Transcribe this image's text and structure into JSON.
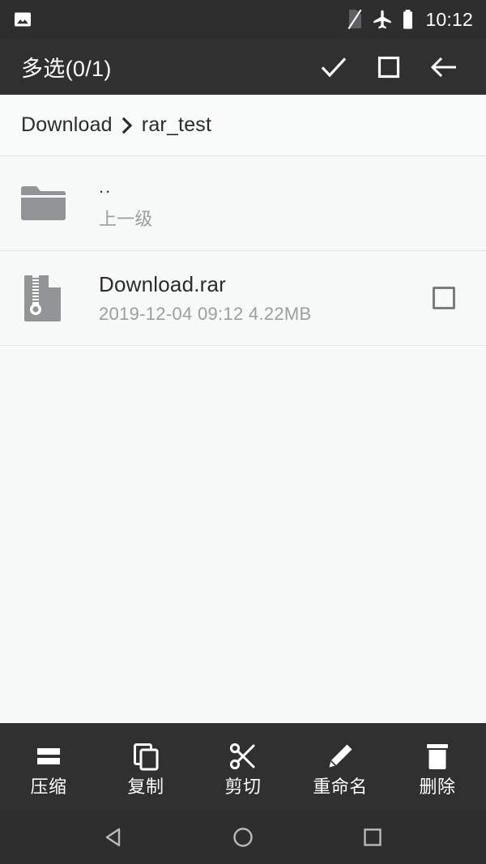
{
  "status_bar": {
    "notification_icon": "image-photo-icon",
    "signal_icon": "no-sim-card-icon",
    "airplane_icon": "airplane-mode-icon",
    "battery_icon": "battery-full-icon",
    "time": "10:12",
    "background_color": "#2e2e2e"
  },
  "action_bar": {
    "title": "多选(0/1)",
    "background_color": "#303030",
    "confirm_icon": "check-icon",
    "select_all_icon": "square-select-all-icon",
    "back_icon": "arrow-left-icon"
  },
  "breadcrumb": {
    "items": [
      {
        "label": "Download"
      },
      {
        "label": "rar_test"
      }
    ],
    "separator_icon": "chevron-right-icon"
  },
  "file_list": {
    "rows": [
      {
        "icon": "folder-icon",
        "title": "..",
        "subtitle": "上一级",
        "has_checkbox": false,
        "checked": false
      },
      {
        "icon": "archive-zip-file-icon",
        "title": "Download.rar",
        "subtitle": "2019-12-04 09:12  4.22MB",
        "has_checkbox": true,
        "checked": false
      }
    ]
  },
  "bottom_toolbar": {
    "items": [
      {
        "label": "压缩",
        "icon": "compress-icon"
      },
      {
        "label": "复制",
        "icon": "copy-icon"
      },
      {
        "label": "剪切",
        "icon": "scissors-cut-icon"
      },
      {
        "label": "重命名",
        "icon": "pencil-rename-icon"
      },
      {
        "label": "删除",
        "icon": "trash-delete-icon"
      }
    ],
    "background_color": "#303030"
  },
  "nav_bar": {
    "back_icon": "nav-back-triangle-icon",
    "home_icon": "nav-home-circle-icon",
    "recents_icon": "nav-recents-square-icon",
    "background_color": "#2e2e2e"
  },
  "colors": {
    "page_background": "#f7f8f8",
    "primary_text": "#2b2b2b",
    "secondary_text": "#9b9d9e",
    "icon_gray": "#929596",
    "divider": "#e4e5e5"
  }
}
